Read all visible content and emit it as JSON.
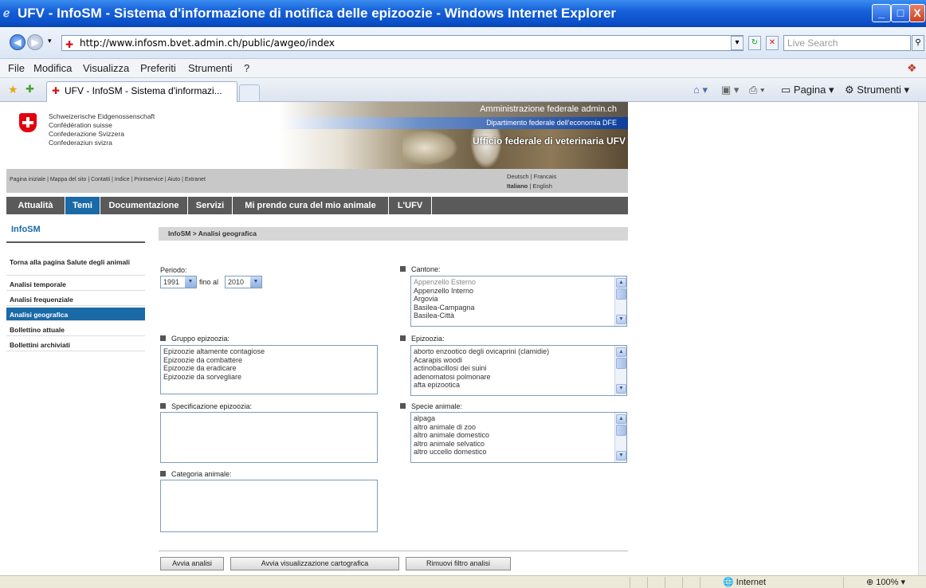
{
  "window": {
    "title": "UFV - InfoSM - Sistema d'informazione di notifica delle epizoozie - Windows Internet Explorer",
    "minimize": "_",
    "maximize": "□",
    "close": "X"
  },
  "address_bar": {
    "url": "http://www.infosm.bvet.admin.ch/public/awgeo/index",
    "search_placeholder": "Live Search"
  },
  "menu": {
    "items": [
      "File",
      "Modifica",
      "Visualizza",
      "Preferiti",
      "Strumenti",
      "?"
    ]
  },
  "tabs": {
    "active": "UFV - InfoSM - Sistema d'informazi...",
    "commands": [
      "Pagina ▾",
      "Strumenti ▾"
    ]
  },
  "site_header": {
    "confederation": [
      "Schweizerische Eidgenossenschaft",
      "Confédération suisse",
      "Confederazione Svizzera",
      "Confederaziun svizra"
    ],
    "admin": "Amministrazione federale admin.ch",
    "department": "Dipartimento federale dell'economia DFE",
    "office": "Ufficio federale di veterinaria UFV"
  },
  "util_links": "Pagina iniziale | Mappa del sito | Contatti | Indice | Printservice | Aiuto | Extranet",
  "languages": {
    "line1": "Deutsch | Francais",
    "current": "Italiano",
    "other": " | English"
  },
  "main_nav": [
    "Attualità",
    "Temi",
    "Documentazione",
    "Servizi",
    "Mi prendo cura del mio animale",
    "L'UFV"
  ],
  "sidebar": {
    "title": "InfoSM",
    "items": [
      "Torna alla pagina Salute degli animali",
      "Analisi temporale",
      "Analisi frequenziale",
      "Analisi geografica",
      "Bollettino attuale",
      "Bollettini archiviati"
    ]
  },
  "breadcrumb": "InfoSM > Analisi geografica",
  "form": {
    "periodo_label": "Periodo:",
    "year_from": "1991",
    "fino_al": "fino al",
    "year_to": "2010",
    "cantone_label": "Cantone:",
    "cantone_options": [
      "Appenzello Esterno",
      "Appenzello Interno",
      "Argovia",
      "Basilea-Campagna",
      "Basilea-Città"
    ],
    "gruppo_label": "Gruppo epizoozia:",
    "gruppo_options": [
      "Epizoozie altamente contagiose",
      "Epizoozie da combattere",
      "Epizoozie da eradicare",
      "Epizoozie da sorvegliare"
    ],
    "epizoozia_label": "Epizoozia:",
    "epizoozia_options": [
      "aborto enzootico degli ovicaprini (clamidie)",
      "Acarapis woodi",
      "actinobacillosi dei suini",
      "adenomatosi polmonare",
      "afta epizootica"
    ],
    "specificazione_label": "Specificazione epizoozia:",
    "specie_label": "Specie animale:",
    "specie_options": [
      "alpaga",
      "altro animale di zoo",
      "altro animale domestico",
      "altro animale selvatico",
      "altro uccello domestico"
    ],
    "categoria_label": "Categoria animale:"
  },
  "buttons": {
    "analysis": "Avvia analisi",
    "map": "Avvia visualizzazione cartografica",
    "reset": "Rimuovi filtro analisi"
  },
  "status": {
    "zone": "Internet",
    "zoom": "100%"
  }
}
